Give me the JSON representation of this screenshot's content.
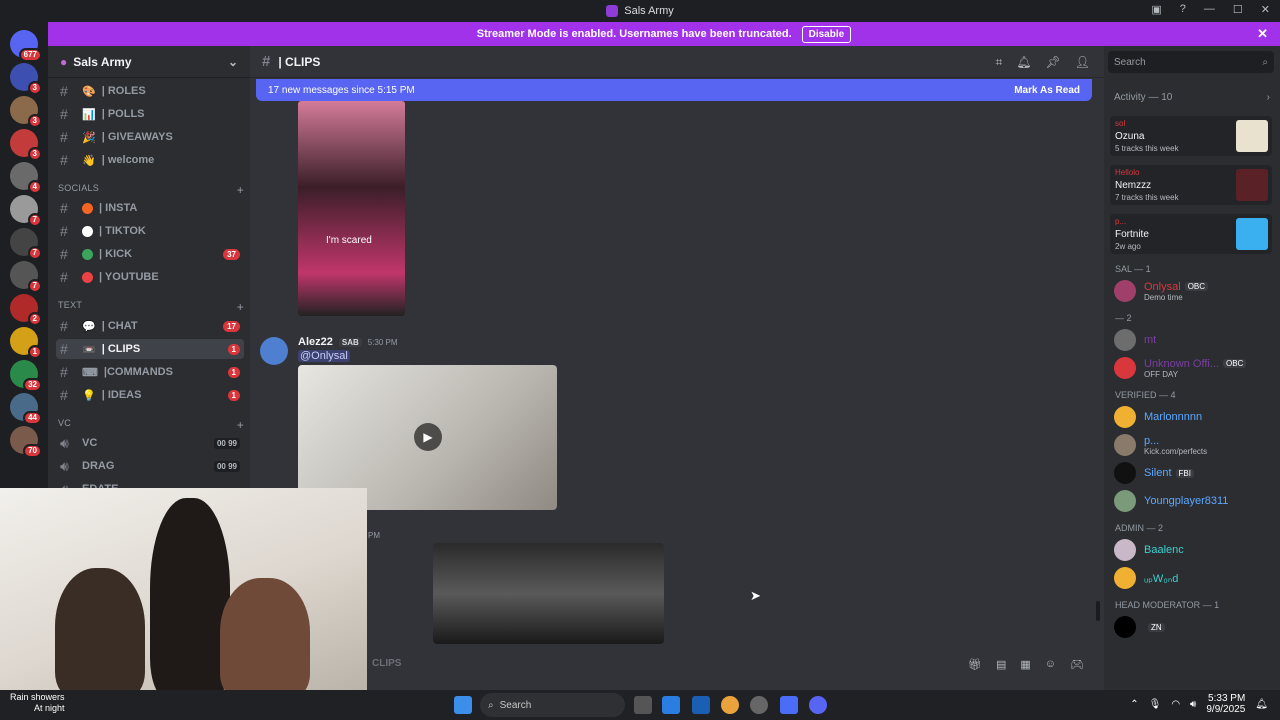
{
  "window": {
    "title": "Sals Army"
  },
  "banner": {
    "text": "Streamer Mode is enabled. Usernames have been truncated.",
    "button": "Disable"
  },
  "guild_badges": [
    "677",
    "3",
    "3",
    "3",
    "4",
    "7",
    "7",
    "7",
    "2",
    "1",
    "32",
    "44",
    "70"
  ],
  "sidebar": {
    "server_name": "Sals Army",
    "channels_top": [
      {
        "label": "| ROLES",
        "emoji": "🎨"
      },
      {
        "label": "| POLLS",
        "emoji": "📊"
      },
      {
        "label": "| GIVEAWAYS",
        "emoji": "🎉"
      },
      {
        "label": "| welcome",
        "emoji": "👋"
      }
    ],
    "cat_socials": "SOCIALS",
    "socials": [
      {
        "label": "| INSTA",
        "color": "#f26522"
      },
      {
        "label": "| TIKTOK",
        "color": "#ffffff"
      },
      {
        "label": "| KICK",
        "color": "#3ba55c",
        "count": "37"
      },
      {
        "label": "| YOUTUBE",
        "color": "#ed4245"
      }
    ],
    "cat_text": "TEXT",
    "text_channels": [
      {
        "label": "| CHAT",
        "emoji": "💬",
        "count": "17"
      },
      {
        "label": "| CLIPS",
        "emoji": "📼",
        "count": "1"
      },
      {
        "label": "|COMMANDS",
        "emoji": "⌨",
        "count": "1"
      },
      {
        "label": "| IDEAS",
        "emoji": "💡",
        "count": "1"
      }
    ],
    "cat_vc": "VC",
    "vc_channels": [
      {
        "label": "VC",
        "meta": "00 99"
      },
      {
        "label": "DRAG",
        "meta": "00 99"
      },
      {
        "label": "EDATE",
        "meta": ""
      }
    ]
  },
  "main": {
    "channel": "| CLIPS",
    "new_messages": "17 new messages since 5:15 PM",
    "mark_read": "Mark As Read",
    "clip_caption": "I'm scared",
    "message": {
      "author": "Alez22",
      "tag": "SAB",
      "time": "5:30 PM",
      "mention": "@Onlysal"
    },
    "message2_time": "PM",
    "composer": "CLIPS"
  },
  "members": {
    "search_placeholder": "Search",
    "activity_header": "Activity — 10",
    "activities": [
      {
        "who": "sol",
        "name": "Ozuna",
        "sub": "5 tracks this week",
        "thumb": "#e9e2cf"
      },
      {
        "who": "Hellolo",
        "name": "Nemzzz",
        "sub": "7 tracks this week",
        "thumb": "#5a2226"
      },
      {
        "who": "p...",
        "name": "Fortnite",
        "sub": "2w ago",
        "thumb": "#3ab0f0"
      }
    ],
    "groups": [
      {
        "title": "SAL — 1",
        "members": [
          {
            "name": "Onlysal",
            "status": "Demo time",
            "color": "#da373c",
            "role": "OBC",
            "av": "#a0406a"
          }
        ]
      },
      {
        "title": "— 2",
        "members": [
          {
            "name": "mt",
            "status": "",
            "color": "#7a3fa0",
            "role": "",
            "av": "#6d6d6d"
          },
          {
            "name": "Unknown Offi...",
            "status": "OFF DAY",
            "color": "#7a3fa0",
            "role": "OBC",
            "av": "#da373c"
          }
        ]
      },
      {
        "title": "VERIFIED — 4",
        "members": [
          {
            "name": "Marlonnnnn",
            "status": "",
            "color": "#5ba8ff",
            "role": "",
            "av": "#f0b132"
          },
          {
            "name": "p...",
            "status": "Kick.com/perfects",
            "color": "#5ba8ff",
            "role": "",
            "av": "#8a7a6a"
          },
          {
            "name": "Silent",
            "status": "",
            "color": "#5ba8ff",
            "role": "FBI",
            "av": "#111111"
          },
          {
            "name": "Youngplayer8311",
            "status": "",
            "color": "#5ba8ff",
            "role": "",
            "av": "#7a9a7a"
          }
        ]
      },
      {
        "title": "ADMIN — 2",
        "members": [
          {
            "name": "Baalenc",
            "status": "",
            "color": "#3bd0d0",
            "role": "",
            "av": "#c9b8c8"
          },
          {
            "name": "ᵤₚW₀ₙd",
            "status": "",
            "color": "#3bd0d0",
            "role": "",
            "av": "#f0b132"
          }
        ]
      },
      {
        "title": "HEAD MODERATOR — 1",
        "members": [
          {
            "name": "",
            "status": "",
            "color": "#ffffff",
            "role": "ZN",
            "av": "#000000"
          }
        ]
      }
    ]
  },
  "taskbar": {
    "weather": "Rain showers",
    "weather_sub": "At night",
    "search": "Search",
    "time": "5:33 PM",
    "date": "9/9/2025"
  }
}
